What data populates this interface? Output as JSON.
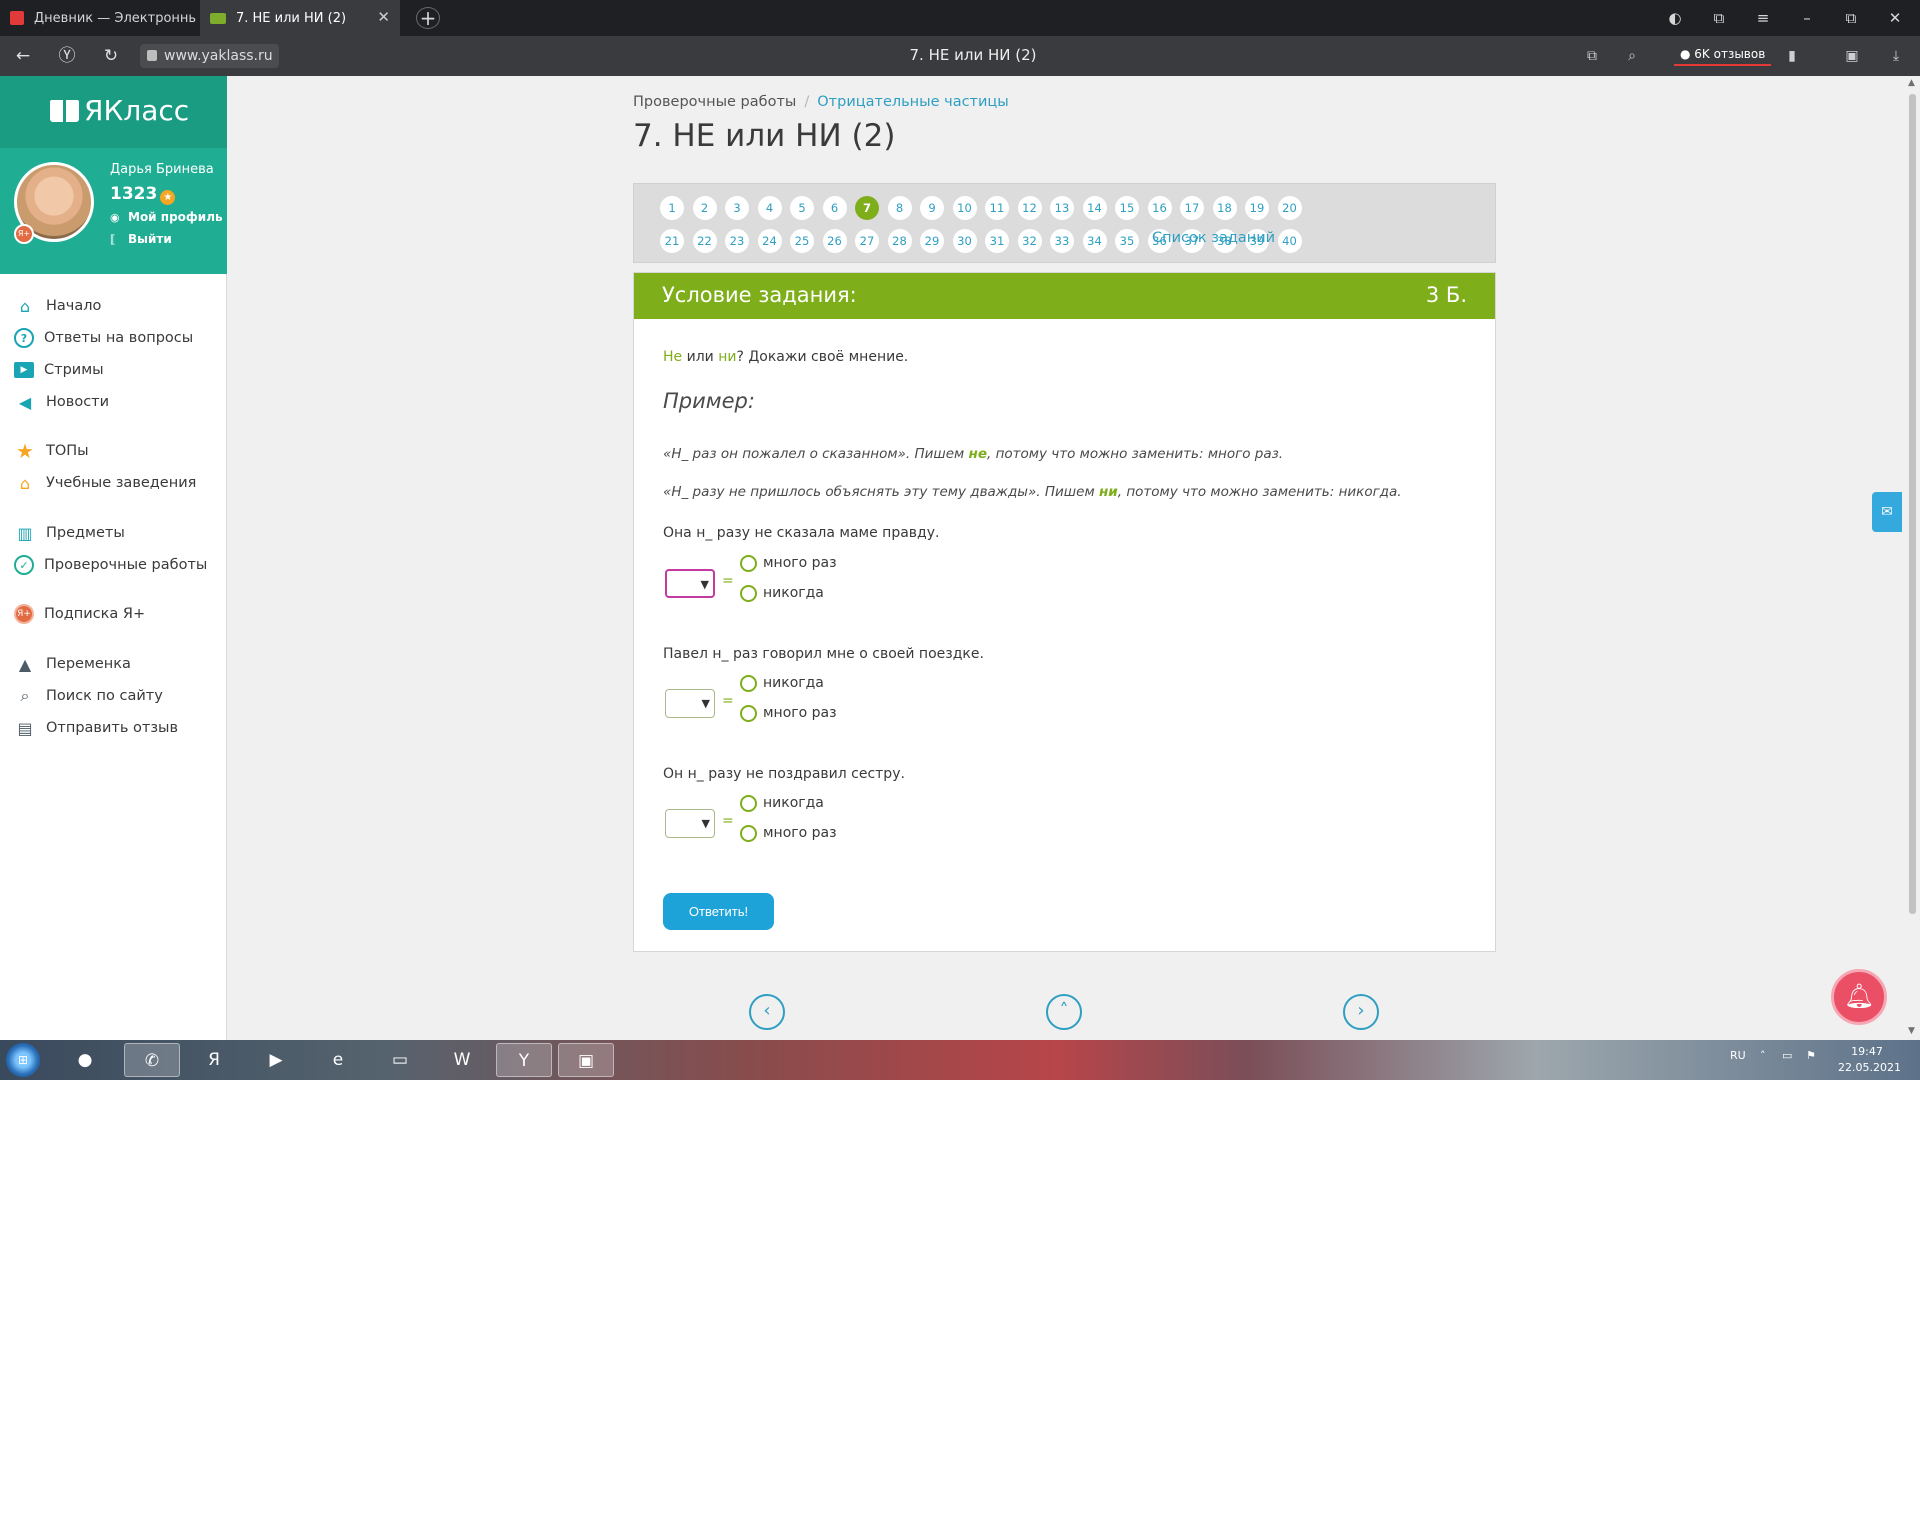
{
  "browser": {
    "tabs": [
      {
        "title": "Дневник — Электронный",
        "active": false
      },
      {
        "title": "7. НЕ или НИ (2)",
        "active": true
      }
    ],
    "new_tab": "+",
    "url": "www.yaklass.ru",
    "page_title": "7. НЕ или НИ (2)",
    "reviews_label": "6K отзывов",
    "window_buttons": {
      "menu": "≡",
      "minimize": "–",
      "restore": "⧉",
      "close": "✕"
    }
  },
  "sidebar": {
    "logo": "ЯКласс",
    "user": {
      "name": "Дарья Бринева",
      "points": "1323",
      "profile_link": "Мой профиль",
      "logout_link": "Выйти"
    },
    "menu": [
      {
        "label": "Начало",
        "icon": "home-icon"
      },
      {
        "label": "Ответы на вопросы",
        "icon": "question-icon"
      },
      {
        "label": "Стримы",
        "icon": "play-icon"
      },
      {
        "label": "Новости",
        "icon": "megaphone-icon"
      },
      {
        "label": "ТОПы",
        "icon": "star-icon"
      },
      {
        "label": "Учебные заведения",
        "icon": "school-icon"
      },
      {
        "label": "Предметы",
        "icon": "books-icon"
      },
      {
        "label": "Проверочные работы",
        "icon": "check-circle-icon"
      },
      {
        "label": "Подписка Я+",
        "icon": "ya-plus-icon"
      },
      {
        "label": "Переменка",
        "icon": "bell-icon"
      },
      {
        "label": "Поиск по сайту",
        "icon": "search-icon"
      },
      {
        "label": "Отправить отзыв",
        "icon": "comment-icon"
      }
    ]
  },
  "breadcrumb": {
    "root": "Проверочные работы",
    "separator": "/",
    "current": "Отрицательные частицы"
  },
  "heading": "7. НЕ или НИ (2)",
  "task_numbers": [
    "1",
    "2",
    "3",
    "4",
    "5",
    "6",
    "7",
    "8",
    "9",
    "10",
    "11",
    "12",
    "13",
    "14",
    "15",
    "16",
    "17",
    "18",
    "19",
    "20",
    "21",
    "22",
    "23",
    "24",
    "25",
    "26",
    "27",
    "28",
    "29",
    "30",
    "31",
    "32",
    "33",
    "34",
    "35",
    "36",
    "37",
    "38",
    "39",
    "40"
  ],
  "active_task": "7",
  "task_list_label": "Список заданий",
  "task": {
    "title": "Условие задания:",
    "points": "3 Б.",
    "intro": {
      "ne": "Не",
      "or": " или ",
      "ni": "ни",
      "rest": "? Докажи своё мнение."
    },
    "example_title": "Пример:",
    "examples": [
      {
        "before": "«Н_ раз он пожалел о сказанном». Пишем ",
        "hl": "не",
        "after": ", потому что  можно заменить: много раз."
      },
      {
        "before": "«Н_ разу не пришлось объяснять эту тему дважды». Пишем ",
        "hl": "ни",
        "after": ", потому что можно заменить: никогда."
      }
    ],
    "questions": [
      {
        "sentence": "Она н_ разу не сказала маме правду.",
        "options": [
          "много раз",
          "никогда"
        ]
      },
      {
        "sentence": "Павел н_ раз говорил мне о своей поездке.",
        "options": [
          "никогда",
          "много раз"
        ]
      },
      {
        "sentence": "Он н_ разу не поздравил сестру.",
        "options": [
          "никогда",
          "много раз"
        ]
      }
    ],
    "equals": "=",
    "answer_button": "Ответить!"
  },
  "pager": {
    "prev": "‹",
    "up": "˄",
    "next": "›"
  },
  "taskbar": {
    "lang": "RU",
    "time": "19:47",
    "date": "22.05.2021"
  },
  "colors": {
    "brand_teal": "#1a9c83",
    "accent_green": "#7fae1b",
    "link_blue": "#2e9fc2",
    "button_blue": "#1da3d8",
    "bell_pink": "#ea4f66"
  }
}
